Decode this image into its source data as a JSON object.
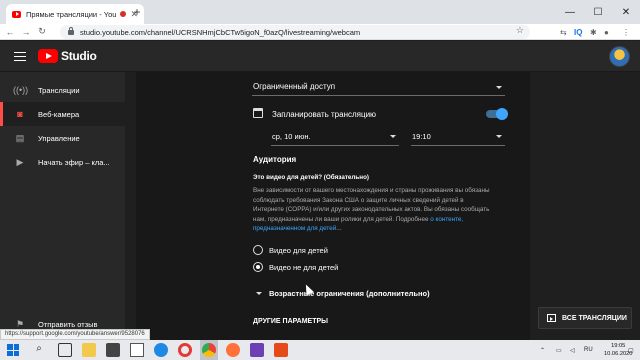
{
  "browser": {
    "tab_title": "Прямые трансляции - YouT",
    "tab_close": "✕",
    "new_tab": "+",
    "window_min": "—",
    "window_max": "☐",
    "window_close": "✕",
    "url": "studio.youtube.com/channel/UCRSNHmjCbCTw5igoN_f0azQ/livestreaming/webcam",
    "ext_iq": "IQ"
  },
  "header": {
    "brand": "Studio"
  },
  "sidebar": {
    "items": [
      {
        "label": "Трансляции",
        "icon": "broadcast-icon",
        "glyph": "((•))"
      },
      {
        "label": "Веб-камера",
        "icon": "camera-icon",
        "glyph": "◙"
      },
      {
        "label": "Управление",
        "icon": "manage-icon",
        "glyph": "▤"
      },
      {
        "label": "Начать эфир – кла...",
        "icon": "start-stream-icon",
        "glyph": "▶"
      }
    ],
    "feedback": "Отправить отзыв"
  },
  "form": {
    "visibility": "Ограниченный доступ",
    "schedule_label": "Запланировать трансляцию",
    "schedule_on": true,
    "date": "ср, 10 июн.",
    "time": "19:10",
    "audience_title": "Аудитория",
    "kids_question": "Это видео для детей? (Обязательно)",
    "kids_desc_1": "Вне зависимости от вашего местонахождения и страны проживания вы обязаны",
    "kids_desc_2": "соблюдать требования Закона США о защите личных сведений детей в",
    "kids_desc_3": "Интернете (COPPA) и/или других законодательных актов. Вы обязаны сообщать",
    "kids_desc_4": "нам, предназначены ли ваши ролики для детей. Подробнее",
    "kids_link_1": "о контенте,",
    "kids_link_2": "предназначенном для детей",
    "kids_desc_end": "...",
    "option_kids": "Видео для детей",
    "option_not_kids": "Видео не для детей",
    "selected_option": "not_kids",
    "age_restriction": "Возрастные ограничения (дополнительно)",
    "other_params": "ДРУГИЕ ПАРАМЕТРЫ"
  },
  "all_streams_button": "ВСЕ ТРАНСЛЯЦИИ",
  "status_url": "https://support.google.com/youtube/answer/9528076",
  "taskbar": {
    "lang": "RU",
    "time": "19:05",
    "date": "10.06.2020"
  },
  "colors": {
    "accent_blue": "#3ea6ff",
    "brand_red": "#ff0000",
    "active_red": "#ff4e45"
  }
}
